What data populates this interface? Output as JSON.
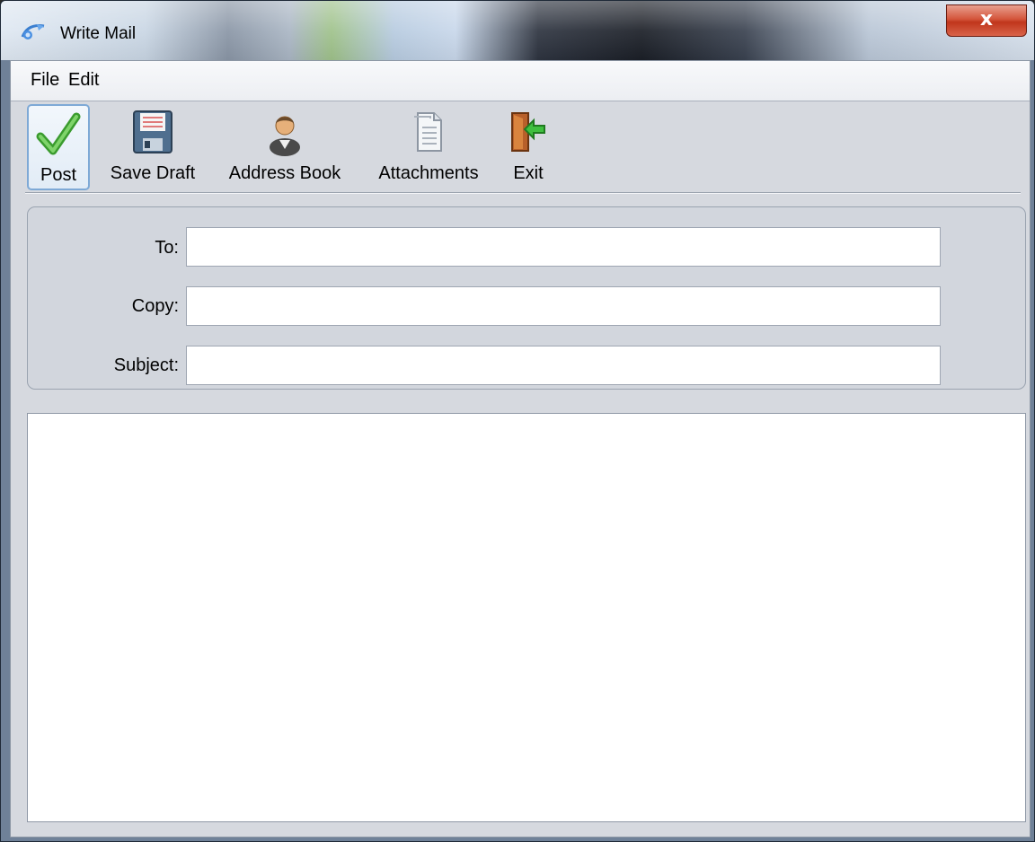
{
  "window": {
    "title": "Write Mail",
    "close_label": "x"
  },
  "menu": {
    "items": [
      "File",
      "Edit"
    ]
  },
  "toolbar": {
    "buttons": [
      {
        "label": "Post",
        "icon": "checkmark-icon",
        "selected": true
      },
      {
        "label": "Save Draft",
        "icon": "floppy-disk-icon"
      },
      {
        "label": "Address Book",
        "icon": "person-icon"
      },
      {
        "label": "Attachments",
        "icon": "document-icon"
      },
      {
        "label": "Exit",
        "icon": "exit-door-icon"
      }
    ]
  },
  "form": {
    "to_label": "To:",
    "to_value": "",
    "copy_label": "Copy:",
    "copy_value": "",
    "subject_label": "Subject:",
    "subject_value": ""
  },
  "body": {
    "value": ""
  },
  "colors": {
    "accent_selected": "#7ea9d6",
    "close_button": "#c0361c",
    "client_bg": "#d6d9df"
  }
}
